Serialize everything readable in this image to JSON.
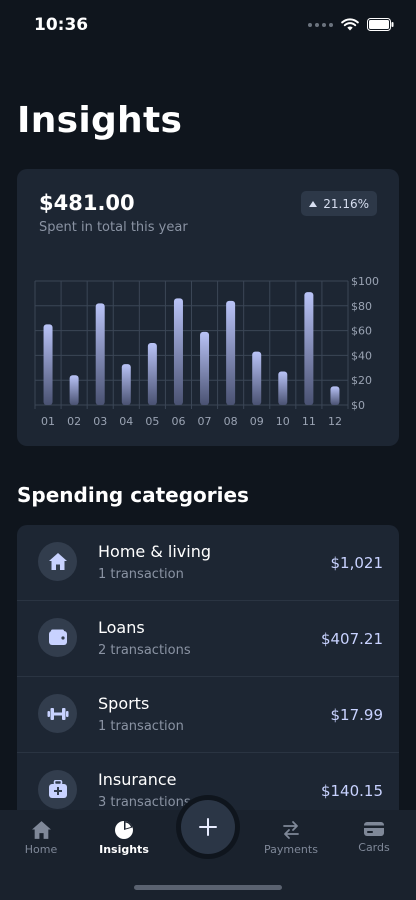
{
  "status": {
    "time": "10:36"
  },
  "page": {
    "title": "Insights"
  },
  "summary": {
    "total": "$481.00",
    "caption": "Spent in total this year",
    "change": "21.16%"
  },
  "chart_data": {
    "type": "bar",
    "categories": [
      "01",
      "02",
      "03",
      "04",
      "05",
      "06",
      "07",
      "08",
      "09",
      "10",
      "11",
      "12"
    ],
    "values": [
      65,
      24,
      82,
      33,
      50,
      86,
      59,
      84,
      43,
      27,
      91,
      15
    ],
    "ylim": [
      0,
      100
    ],
    "yticks": [
      "$0",
      "$20",
      "$40",
      "$60",
      "$80",
      "$100"
    ],
    "ytick_values": [
      0,
      20,
      40,
      60,
      80,
      100
    ],
    "grid": true,
    "colors": {
      "bar_top": "#b9c3f7",
      "bar_bottom": "#4a5272",
      "grid": "#3b4656"
    }
  },
  "categories_section": {
    "title": "Spending categories",
    "items": [
      {
        "name": "Home & living",
        "sub": "1 transaction",
        "amount": "$1,021",
        "icon": "home-icon"
      },
      {
        "name": "Loans",
        "sub": "2 transactions",
        "amount": "$407.21",
        "icon": "wallet-icon"
      },
      {
        "name": "Sports",
        "sub": "1 transaction",
        "amount": "$17.99",
        "icon": "dumbbell-icon"
      },
      {
        "name": "Insurance",
        "sub": "3 transactions",
        "amount": "$140.15",
        "icon": "medical-kit-icon"
      }
    ]
  },
  "tabs": [
    {
      "label": "Home",
      "icon": "home-icon",
      "active": false
    },
    {
      "label": "Insights",
      "icon": "pie-chart-icon",
      "active": true
    },
    {
      "label": "Payments",
      "icon": "transfer-icon",
      "active": false
    },
    {
      "label": "Cards",
      "icon": "card-icon",
      "active": false
    }
  ],
  "colors": {
    "accent": "#c8d2ff",
    "background": "#0f151d",
    "card": "#1d2633"
  }
}
